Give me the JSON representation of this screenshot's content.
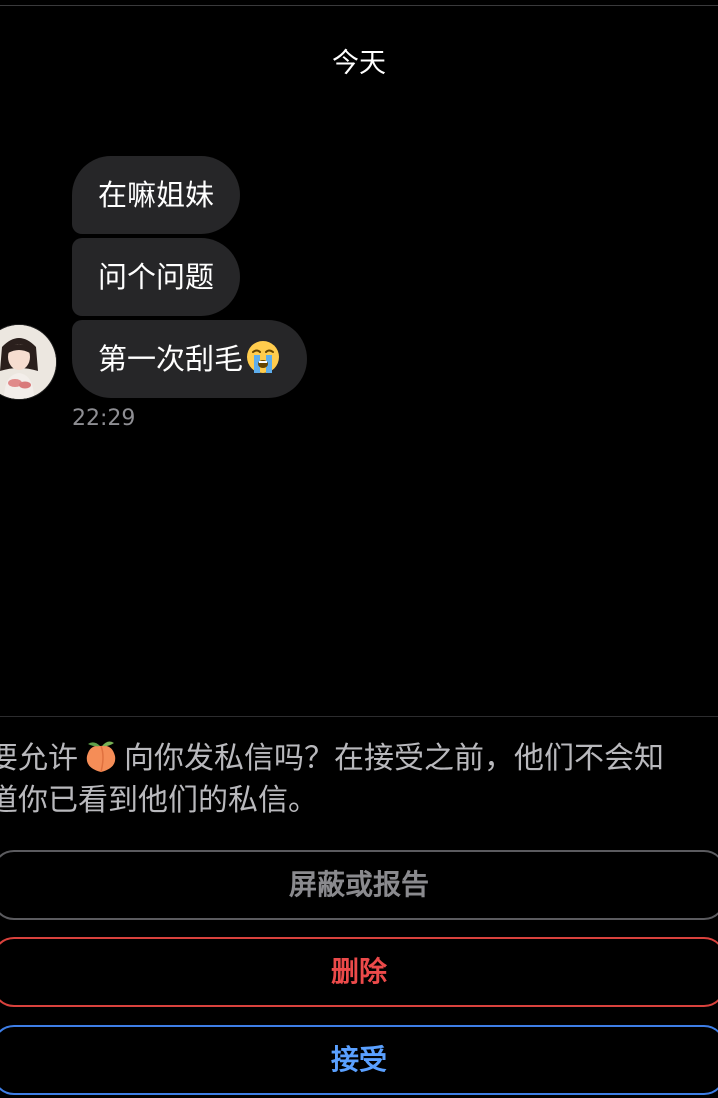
{
  "chat": {
    "date_divider": "今天",
    "messages": [
      {
        "text": "在嘛姐妹"
      },
      {
        "text": "问个问题"
      },
      {
        "text": "第一次刮毛",
        "emoji": "loudly-crying-face"
      }
    ],
    "timestamp": "22:29"
  },
  "request": {
    "line1_prefix": "要允许",
    "sender_emoji": "peach",
    "line1_suffix": "向你发私信吗？在接受之前，他们不会知",
    "line2": "道你已看到他们的私信。"
  },
  "actions": {
    "block_label": "屏蔽或报告",
    "delete_label": "删除",
    "accept_label": "接受"
  },
  "colors": {
    "background": "#000000",
    "bubble": "#262628",
    "delete": "#ec4a4a",
    "accept": "#5aa0ff",
    "muted_text": "#8e8e93"
  }
}
